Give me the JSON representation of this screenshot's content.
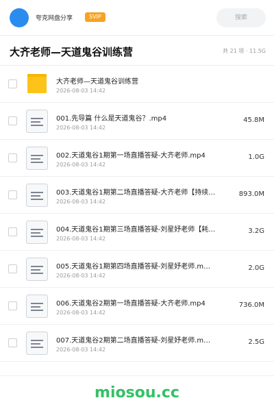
{
  "header": {
    "username": "夸克网盘分享",
    "badge": "SVIP",
    "search_placeholder": "搜索"
  },
  "folder": {
    "title": "大齐老师—天道鬼谷训练营",
    "meta": "共 21 项 · 11.5G"
  },
  "files": [
    {
      "type": "folder",
      "name": "大齐老师—天道鬼谷训练营",
      "date": "2026-08-03 14:42",
      "size": ""
    },
    {
      "type": "file",
      "name": "001.先导篇 什么是天道鬼谷？.mp4",
      "date": "2026-08-03 14:42",
      "size": "45.8M"
    },
    {
      "type": "file",
      "name": "002.天道鬼谷1期第一场直播答疑-大齐老师.mp4",
      "date": "2026-08-03 14:42",
      "size": "1.0G"
    },
    {
      "type": "file",
      "name": "003.天道鬼谷1期第二场直播答疑-大齐老师【持续…",
      "date": "2026-08-03 14:42",
      "size": "893.0M"
    },
    {
      "type": "file",
      "name": "004.天道鬼谷1期第三场直播答疑-刘星妤老师【耗…",
      "date": "2026-08-03 14:42",
      "size": "3.2G"
    },
    {
      "type": "file",
      "name": "005.天道鬼谷1期第四场直播答疑-刘星妤老师.m…",
      "date": "2026-08-03 14:42",
      "size": "2.0G"
    },
    {
      "type": "file",
      "name": "006.天道鬼谷2期第一场直播答疑-大齐老师.mp4",
      "date": "2026-08-03 14:42",
      "size": "736.0M"
    },
    {
      "type": "file",
      "name": "007.天道鬼谷2期第二场直播答疑-刘星妤老师.m…",
      "date": "2026-08-03 14:42",
      "size": "2.5G"
    }
  ],
  "footer": {
    "watermark": "miosou.cc"
  },
  "colors": {
    "avatar": "#2b8cf0",
    "svip": "#f6a323",
    "folder": "#fcc419",
    "watermark": "#33c166"
  }
}
